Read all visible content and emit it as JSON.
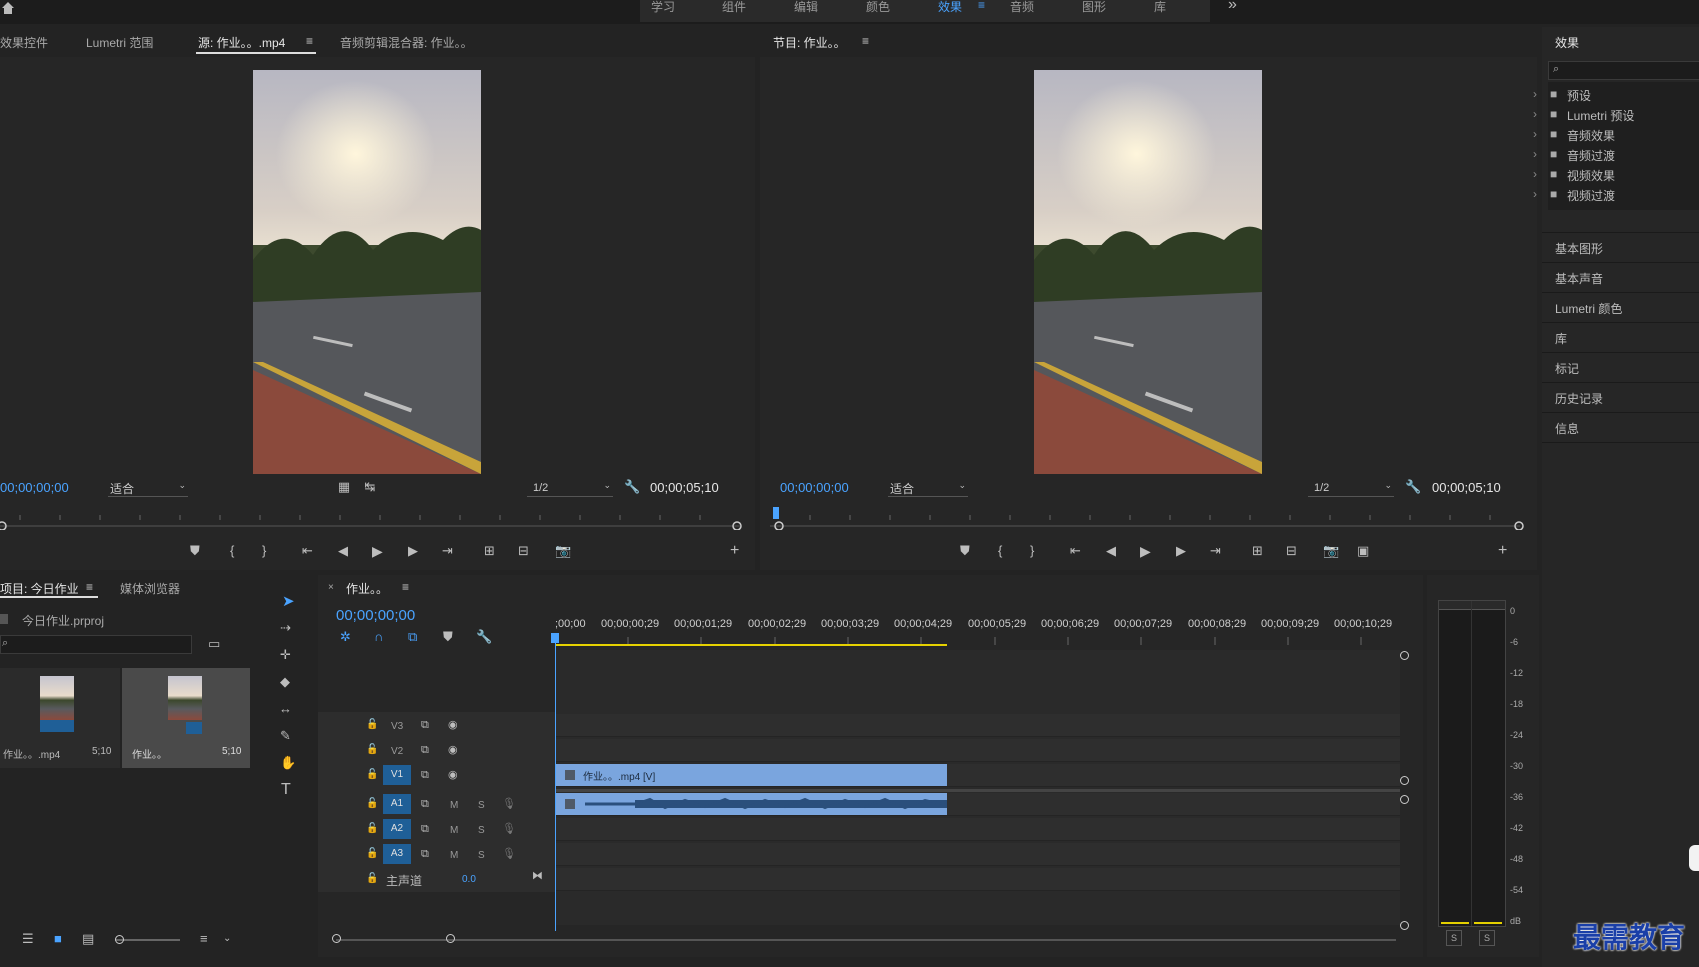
{
  "workspace_tabs": [
    "学习",
    "组件",
    "编辑",
    "颜色",
    "效果",
    "音频",
    "图形",
    "库"
  ],
  "workspace_active": "效果",
  "overflow": "»",
  "source_panel": {
    "tabs": [
      "效果控件",
      "Lumetri 范围",
      "源: 作业。。.mp4",
      "音频剪辑混合器: 作业。。"
    ],
    "timecode_in": "00;00;00;00",
    "fit": "适合",
    "resolution": "1/2",
    "timecode_dur": "00;00;05;10"
  },
  "program_panel": {
    "title": "节目: 作业。。",
    "timecode_in": "00;00;00;00",
    "fit": "适合",
    "resolution": "1/2",
    "timecode_dur": "00;00;05;10"
  },
  "project_panel": {
    "tabs": [
      "项目: 今日作业",
      "媒体浏览器"
    ],
    "file": "今日作业.prproj",
    "items": [
      {
        "name": "作业。。.mp4",
        "duration": "5;10"
      },
      {
        "name": "作业。。",
        "duration": "5;10"
      }
    ]
  },
  "timeline": {
    "tab": "作业。。",
    "timecode": "00;00;00;00",
    "ruler": [
      ";00;00",
      "00;00;00;29",
      "00;00;01;29",
      "00;00;02;29",
      "00;00;03;29",
      "00;00;04;29",
      "00;00;05;29",
      "00;00;06;29",
      "00;00;07;29",
      "00;00;08;29",
      "00;00;09;29",
      "00;00;10;29"
    ],
    "video_tracks": [
      "V3",
      "V2",
      "V1"
    ],
    "audio_tracks": [
      "A1",
      "A2",
      "A3"
    ],
    "master": "主声道",
    "master_value": "0.0",
    "clip_label": "作业。。.mp4 [V]",
    "m": "M",
    "s": "S"
  },
  "effects_panel": {
    "title": "效果",
    "folders": [
      "预设",
      "Lumetri 预设",
      "音频效果",
      "音频过渡",
      "视频效果",
      "视频过渡"
    ],
    "panels": [
      "基本图形",
      "基本声音",
      "Lumetri 颜色",
      "库",
      "标记",
      "历史记录",
      "信息"
    ]
  },
  "meter": {
    "scale": [
      "0",
      "-6",
      "-12",
      "-18",
      "-24",
      "-30",
      "-36",
      "-42",
      "-48",
      "-54",
      "dB"
    ],
    "solo": [
      "S",
      "S"
    ]
  },
  "watermark": "最需教育",
  "colors": {
    "accent": "#4aa3ff",
    "track_target": "#1f5f97",
    "clip": "#7aa5de",
    "yellow": "#e4d000"
  }
}
